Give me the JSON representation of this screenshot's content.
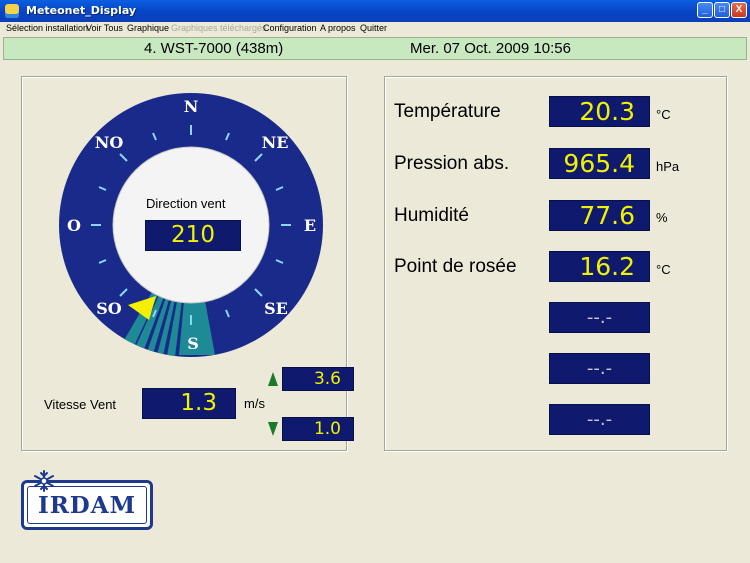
{
  "window": {
    "title": "Meteonet_Display",
    "minimize": "_",
    "maximize": "□",
    "close": "X"
  },
  "menu": [
    "Sélection installation",
    "Voir Tous",
    "Graphique",
    "Graphiques téléchargés",
    "Configuration",
    "A propos",
    "Quitter"
  ],
  "menu_disabled": [
    false,
    false,
    false,
    true,
    false,
    false,
    false
  ],
  "status": {
    "station": "4. WST-7000  (438m)",
    "datetime": "Mer.   07 Oct. 2009   10:56"
  },
  "compass": {
    "labels": {
      "n": "N",
      "ne": "NE",
      "e": "E",
      "se": "SE",
      "s": "S",
      "so": "SO",
      "o": "O",
      "no": "NO"
    },
    "direction_label": "Direction vent",
    "direction_value": "210",
    "direction_deg": 210,
    "color_ring": "#1a2a8a",
    "color_sector": "#1e8a96",
    "color_pointer": "#f5ef00"
  },
  "wind": {
    "label": "Vitesse Vent",
    "value": "1.3",
    "unit": "m/s",
    "max": "3.6",
    "min": "1.0"
  },
  "measures": [
    {
      "label": "Température",
      "value": "20.3",
      "unit": "°C"
    },
    {
      "label": "Pression abs.",
      "value": "965.4",
      "unit": "hPa"
    },
    {
      "label": "Humidité",
      "value": "77.6",
      "unit": "%"
    },
    {
      "label": "Point de rosée",
      "value": "16.2",
      "unit": "°C"
    }
  ],
  "empty_displays": [
    "--.-",
    "--.-",
    "--.-"
  ],
  "logo": {
    "text": "IRDAM"
  }
}
